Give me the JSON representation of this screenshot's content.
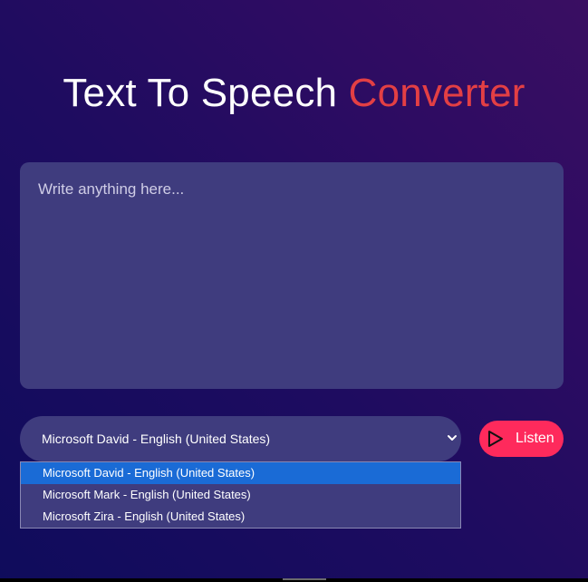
{
  "header": {
    "title_main": "Text To Speech",
    "title_accent": "Converter"
  },
  "text_input": {
    "placeholder": "Write anything here...",
    "value": ""
  },
  "voice_select": {
    "selected": "Microsoft David - English (United States)",
    "options": [
      "Microsoft David - English (United States)",
      "Microsoft Mark - English (United States)",
      "Microsoft Zira - English (United States)"
    ]
  },
  "listen_button": {
    "label": "Listen",
    "icon": "play-icon"
  },
  "colors": {
    "accent": "#e33f44",
    "button": "#fe2a5c",
    "panel": "#3f3c7e",
    "option_highlight": "#1a6bd6"
  }
}
